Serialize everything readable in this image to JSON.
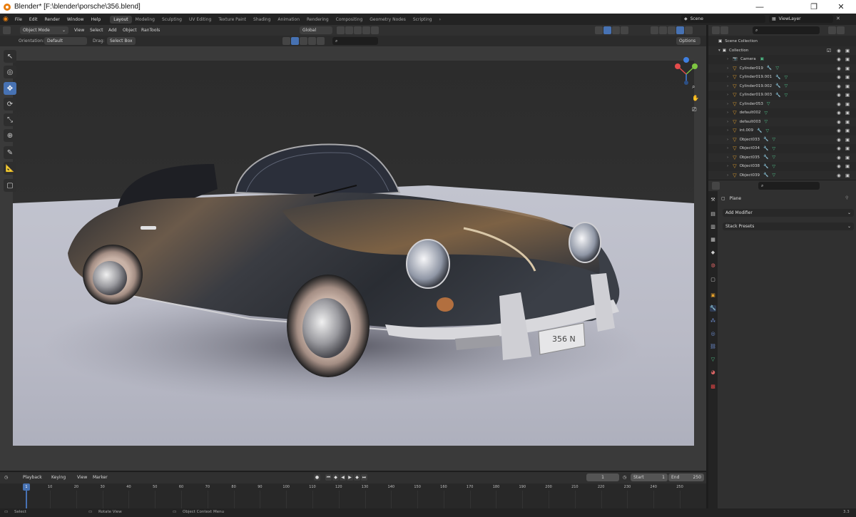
{
  "window": {
    "title": "Blender* [F:\\blender\\porsche\\356.blend]",
    "minimize": "—",
    "restore": "❐",
    "close": "✕"
  },
  "menu": [
    "File",
    "Edit",
    "Render",
    "Window",
    "Help"
  ],
  "workspaces": [
    "Layout",
    "Modeling",
    "Sculpting",
    "UV Editing",
    "Texture Paint",
    "Shading",
    "Animation",
    "Rendering",
    "Compositing",
    "Geometry Nodes",
    "Scripting"
  ],
  "scene": {
    "label": "Scene",
    "view_layer": "ViewLayer"
  },
  "viewport_header": {
    "mode": "Object Mode",
    "menus": [
      "View",
      "Select",
      "Add",
      "Object",
      "RanTools"
    ],
    "transform": "Global",
    "orientation_label": "Orientation:",
    "orientation_value": "Default",
    "drag_label": "Drag:",
    "drag_value": "Select Box",
    "options": "Options"
  },
  "outliner": {
    "scene_collection": "Scene Collection",
    "collection": "Collection",
    "items": [
      {
        "name": "Camera",
        "type": "camera"
      },
      {
        "name": "Cylinder019",
        "type": "mesh"
      },
      {
        "name": "Cylinder019.001",
        "type": "mesh"
      },
      {
        "name": "Cylinder019.002",
        "type": "mesh"
      },
      {
        "name": "Cylinder019.003",
        "type": "mesh"
      },
      {
        "name": "Cylinder053",
        "type": "mesh"
      },
      {
        "name": "default002",
        "type": "mesh"
      },
      {
        "name": "default003",
        "type": "mesh"
      },
      {
        "name": "int.009",
        "type": "mesh"
      },
      {
        "name": "Object033",
        "type": "mesh"
      },
      {
        "name": "Object034",
        "type": "mesh"
      },
      {
        "name": "Object035",
        "type": "mesh"
      },
      {
        "name": "Object038",
        "type": "mesh"
      },
      {
        "name": "Object039",
        "type": "mesh"
      }
    ]
  },
  "properties": {
    "object": "Plane",
    "add_modifier": "Add Modifier",
    "stack_presets": "Stack Presets"
  },
  "timeline": {
    "menus": [
      "Playback",
      "Keying",
      "View",
      "Marker"
    ],
    "current_frame": "1",
    "start_label": "Start",
    "start": "1",
    "end_label": "End",
    "end": "250",
    "ticks": [
      "1",
      "10",
      "20",
      "30",
      "40",
      "50",
      "60",
      "70",
      "80",
      "90",
      "100",
      "110",
      "120",
      "130",
      "140",
      "150",
      "160",
      "170",
      "180",
      "190",
      "200",
      "210",
      "220",
      "230",
      "240",
      "250"
    ]
  },
  "status": {
    "select": "Select",
    "rotate": "Rotate View",
    "context": "Object Context Menu",
    "version": "3.3"
  },
  "plate": "356 N",
  "colors": {
    "accent": "#4772b3",
    "object_icon": "#e39f2c",
    "mesh_icon": "#4fc28a",
    "axis_x": "#e44b4b",
    "axis_y": "#7fc641",
    "axis_z": "#3f7fe0"
  }
}
